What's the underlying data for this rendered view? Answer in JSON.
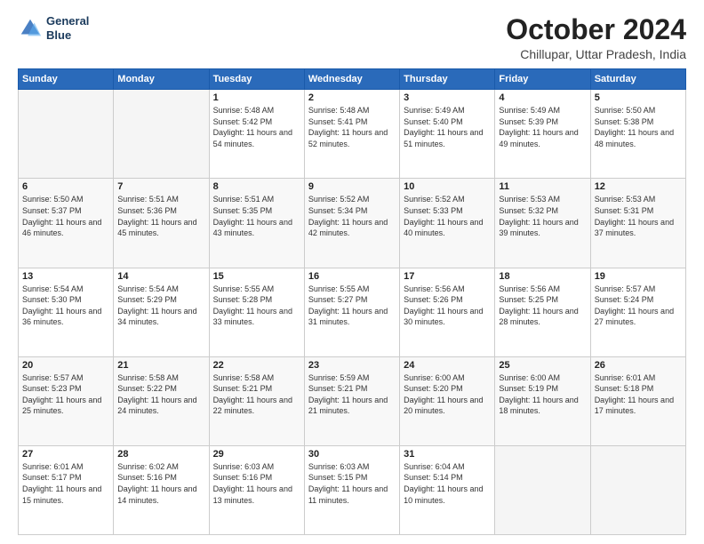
{
  "logo": {
    "line1": "General",
    "line2": "Blue"
  },
  "title": "October 2024",
  "subtitle": "Chillupar, Uttar Pradesh, India",
  "weekdays": [
    "Sunday",
    "Monday",
    "Tuesday",
    "Wednesday",
    "Thursday",
    "Friday",
    "Saturday"
  ],
  "weeks": [
    [
      {
        "day": "",
        "sunrise": "",
        "sunset": "",
        "daylight": ""
      },
      {
        "day": "",
        "sunrise": "",
        "sunset": "",
        "daylight": ""
      },
      {
        "day": "1",
        "sunrise": "Sunrise: 5:48 AM",
        "sunset": "Sunset: 5:42 PM",
        "daylight": "Daylight: 11 hours and 54 minutes."
      },
      {
        "day": "2",
        "sunrise": "Sunrise: 5:48 AM",
        "sunset": "Sunset: 5:41 PM",
        "daylight": "Daylight: 11 hours and 52 minutes."
      },
      {
        "day": "3",
        "sunrise": "Sunrise: 5:49 AM",
        "sunset": "Sunset: 5:40 PM",
        "daylight": "Daylight: 11 hours and 51 minutes."
      },
      {
        "day": "4",
        "sunrise": "Sunrise: 5:49 AM",
        "sunset": "Sunset: 5:39 PM",
        "daylight": "Daylight: 11 hours and 49 minutes."
      },
      {
        "day": "5",
        "sunrise": "Sunrise: 5:50 AM",
        "sunset": "Sunset: 5:38 PM",
        "daylight": "Daylight: 11 hours and 48 minutes."
      }
    ],
    [
      {
        "day": "6",
        "sunrise": "Sunrise: 5:50 AM",
        "sunset": "Sunset: 5:37 PM",
        "daylight": "Daylight: 11 hours and 46 minutes."
      },
      {
        "day": "7",
        "sunrise": "Sunrise: 5:51 AM",
        "sunset": "Sunset: 5:36 PM",
        "daylight": "Daylight: 11 hours and 45 minutes."
      },
      {
        "day": "8",
        "sunrise": "Sunrise: 5:51 AM",
        "sunset": "Sunset: 5:35 PM",
        "daylight": "Daylight: 11 hours and 43 minutes."
      },
      {
        "day": "9",
        "sunrise": "Sunrise: 5:52 AM",
        "sunset": "Sunset: 5:34 PM",
        "daylight": "Daylight: 11 hours and 42 minutes."
      },
      {
        "day": "10",
        "sunrise": "Sunrise: 5:52 AM",
        "sunset": "Sunset: 5:33 PM",
        "daylight": "Daylight: 11 hours and 40 minutes."
      },
      {
        "day": "11",
        "sunrise": "Sunrise: 5:53 AM",
        "sunset": "Sunset: 5:32 PM",
        "daylight": "Daylight: 11 hours and 39 minutes."
      },
      {
        "day": "12",
        "sunrise": "Sunrise: 5:53 AM",
        "sunset": "Sunset: 5:31 PM",
        "daylight": "Daylight: 11 hours and 37 minutes."
      }
    ],
    [
      {
        "day": "13",
        "sunrise": "Sunrise: 5:54 AM",
        "sunset": "Sunset: 5:30 PM",
        "daylight": "Daylight: 11 hours and 36 minutes."
      },
      {
        "day": "14",
        "sunrise": "Sunrise: 5:54 AM",
        "sunset": "Sunset: 5:29 PM",
        "daylight": "Daylight: 11 hours and 34 minutes."
      },
      {
        "day": "15",
        "sunrise": "Sunrise: 5:55 AM",
        "sunset": "Sunset: 5:28 PM",
        "daylight": "Daylight: 11 hours and 33 minutes."
      },
      {
        "day": "16",
        "sunrise": "Sunrise: 5:55 AM",
        "sunset": "Sunset: 5:27 PM",
        "daylight": "Daylight: 11 hours and 31 minutes."
      },
      {
        "day": "17",
        "sunrise": "Sunrise: 5:56 AM",
        "sunset": "Sunset: 5:26 PM",
        "daylight": "Daylight: 11 hours and 30 minutes."
      },
      {
        "day": "18",
        "sunrise": "Sunrise: 5:56 AM",
        "sunset": "Sunset: 5:25 PM",
        "daylight": "Daylight: 11 hours and 28 minutes."
      },
      {
        "day": "19",
        "sunrise": "Sunrise: 5:57 AM",
        "sunset": "Sunset: 5:24 PM",
        "daylight": "Daylight: 11 hours and 27 minutes."
      }
    ],
    [
      {
        "day": "20",
        "sunrise": "Sunrise: 5:57 AM",
        "sunset": "Sunset: 5:23 PM",
        "daylight": "Daylight: 11 hours and 25 minutes."
      },
      {
        "day": "21",
        "sunrise": "Sunrise: 5:58 AM",
        "sunset": "Sunset: 5:22 PM",
        "daylight": "Daylight: 11 hours and 24 minutes."
      },
      {
        "day": "22",
        "sunrise": "Sunrise: 5:58 AM",
        "sunset": "Sunset: 5:21 PM",
        "daylight": "Daylight: 11 hours and 22 minutes."
      },
      {
        "day": "23",
        "sunrise": "Sunrise: 5:59 AM",
        "sunset": "Sunset: 5:21 PM",
        "daylight": "Daylight: 11 hours and 21 minutes."
      },
      {
        "day": "24",
        "sunrise": "Sunrise: 6:00 AM",
        "sunset": "Sunset: 5:20 PM",
        "daylight": "Daylight: 11 hours and 20 minutes."
      },
      {
        "day": "25",
        "sunrise": "Sunrise: 6:00 AM",
        "sunset": "Sunset: 5:19 PM",
        "daylight": "Daylight: 11 hours and 18 minutes."
      },
      {
        "day": "26",
        "sunrise": "Sunrise: 6:01 AM",
        "sunset": "Sunset: 5:18 PM",
        "daylight": "Daylight: 11 hours and 17 minutes."
      }
    ],
    [
      {
        "day": "27",
        "sunrise": "Sunrise: 6:01 AM",
        "sunset": "Sunset: 5:17 PM",
        "daylight": "Daylight: 11 hours and 15 minutes."
      },
      {
        "day": "28",
        "sunrise": "Sunrise: 6:02 AM",
        "sunset": "Sunset: 5:16 PM",
        "daylight": "Daylight: 11 hours and 14 minutes."
      },
      {
        "day": "29",
        "sunrise": "Sunrise: 6:03 AM",
        "sunset": "Sunset: 5:16 PM",
        "daylight": "Daylight: 11 hours and 13 minutes."
      },
      {
        "day": "30",
        "sunrise": "Sunrise: 6:03 AM",
        "sunset": "Sunset: 5:15 PM",
        "daylight": "Daylight: 11 hours and 11 minutes."
      },
      {
        "day": "31",
        "sunrise": "Sunrise: 6:04 AM",
        "sunset": "Sunset: 5:14 PM",
        "daylight": "Daylight: 11 hours and 10 minutes."
      },
      {
        "day": "",
        "sunrise": "",
        "sunset": "",
        "daylight": ""
      },
      {
        "day": "",
        "sunrise": "",
        "sunset": "",
        "daylight": ""
      }
    ]
  ]
}
